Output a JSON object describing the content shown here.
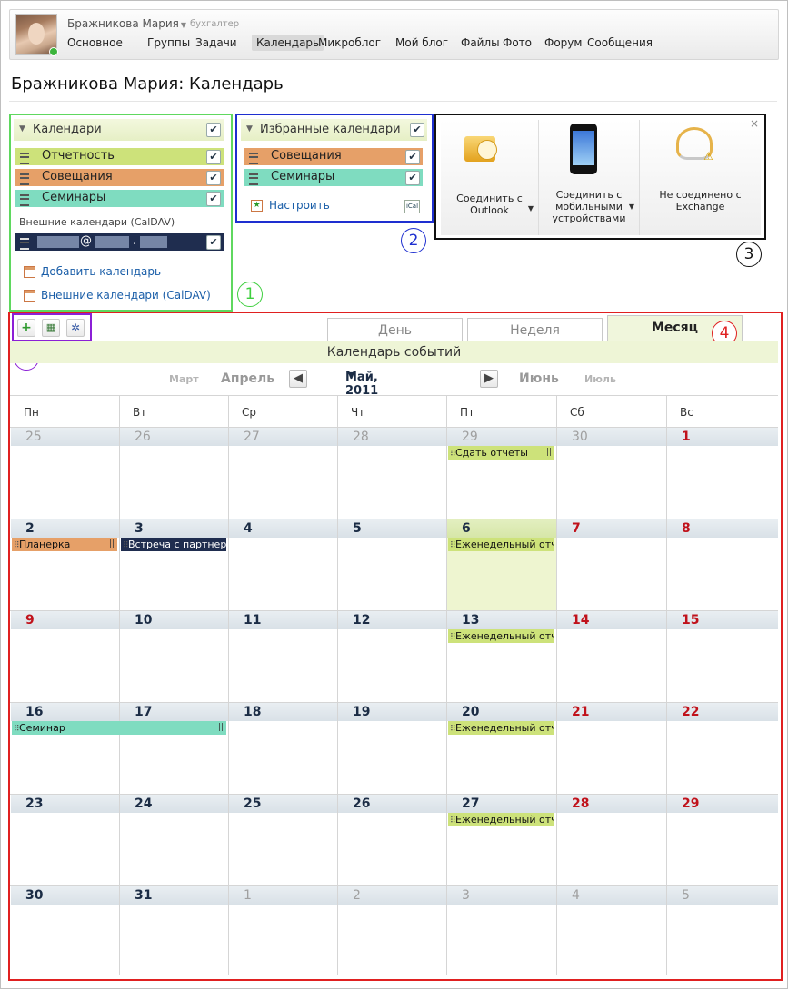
{
  "user": {
    "name": "Бражникова Мария",
    "position": "бухгалтер"
  },
  "nav": [
    {
      "label": "Основное"
    },
    {
      "label": "Группы"
    },
    {
      "label": "Задачи"
    },
    {
      "label": "Календарь",
      "active": true
    },
    {
      "label": "Микроблог"
    },
    {
      "label": "Мой блог"
    },
    {
      "label": "Файлы"
    },
    {
      "label": "Фото"
    },
    {
      "label": "Форум"
    },
    {
      "label": "Сообщения"
    }
  ],
  "page_title": "Бражникова Мария: Календарь",
  "calendars_panel": {
    "title": "Календари",
    "items": [
      {
        "label": "Отчетность",
        "color": "#cde27a"
      },
      {
        "label": "Совещания",
        "color": "#e6a068"
      },
      {
        "label": "Семинары",
        "color": "#7fdcc0"
      }
    ],
    "external_title": "Внешние календари (CalDAV)",
    "external_item": {
      "label": "@.",
      "color": "#1f2d4f"
    },
    "add_link": "Добавить календарь",
    "external_link": "Внешние календари (CalDAV)"
  },
  "favorites_panel": {
    "title": "Избранные календари",
    "items": [
      {
        "label": "Совещания",
        "color": "#e6a068"
      },
      {
        "label": "Семинары",
        "color": "#7fdcc0"
      }
    ],
    "settings_link": "Настроить"
  },
  "connect_panel": {
    "outlook": "Соединить с Outlook",
    "mobile": "Соединить с мобильными устройствами",
    "exchange": "Не соединено с Exchange",
    "close": "×"
  },
  "callouts": [
    "1",
    "2",
    "3",
    "4",
    "5"
  ],
  "tabs": {
    "day": "День",
    "week": "Неделя",
    "month": "Месяц"
  },
  "events_bar": "Календарь событий",
  "month_nav": {
    "prev2": "Март",
    "prev1": "Апрель",
    "current": "Май, 2011",
    "next1": "Июнь",
    "next2": "Июль"
  },
  "weekdays": [
    "Пн",
    "Вт",
    "Ср",
    "Чт",
    "Пт",
    "Сб",
    "Вс"
  ],
  "weeks": [
    [
      {
        "d": "25",
        "o": true
      },
      {
        "d": "26",
        "o": true
      },
      {
        "d": "27",
        "o": true
      },
      {
        "d": "28",
        "o": true
      },
      {
        "d": "29",
        "o": true
      },
      {
        "d": "30",
        "o": true
      },
      {
        "d": "1",
        "w": true
      }
    ],
    [
      {
        "d": "2"
      },
      {
        "d": "3"
      },
      {
        "d": "4"
      },
      {
        "d": "5"
      },
      {
        "d": "6",
        "t": true
      },
      {
        "d": "7",
        "w": true
      },
      {
        "d": "8",
        "w": true
      }
    ],
    [
      {
        "d": "9",
        "w": true
      },
      {
        "d": "10"
      },
      {
        "d": "11"
      },
      {
        "d": "12"
      },
      {
        "d": "13"
      },
      {
        "d": "14",
        "w": true
      },
      {
        "d": "15",
        "w": true
      }
    ],
    [
      {
        "d": "16"
      },
      {
        "d": "17"
      },
      {
        "d": "18"
      },
      {
        "d": "19"
      },
      {
        "d": "20"
      },
      {
        "d": "21",
        "w": true
      },
      {
        "d": "22",
        "w": true
      }
    ],
    [
      {
        "d": "23"
      },
      {
        "d": "24"
      },
      {
        "d": "25"
      },
      {
        "d": "26"
      },
      {
        "d": "27"
      },
      {
        "d": "28",
        "w": true
      },
      {
        "d": "29",
        "w": true
      }
    ],
    [
      {
        "d": "30"
      },
      {
        "d": "31"
      },
      {
        "d": "1",
        "o": true
      },
      {
        "d": "2",
        "o": true
      },
      {
        "d": "3",
        "o": true
      },
      {
        "d": "4",
        "o": true
      },
      {
        "d": "5",
        "o": true
      }
    ]
  ],
  "events": [
    {
      "week": 0,
      "col": 4,
      "span": 1,
      "label": "Сдать отчеты",
      "color": "#cde27a",
      "text_color": "#111",
      "end": "||"
    },
    {
      "week": 1,
      "col": 0,
      "span": 1,
      "label": "Планерка",
      "color": "#e6a068",
      "text_color": "#111",
      "end": "||"
    },
    {
      "week": 1,
      "col": 1,
      "span": 1,
      "label": "Встреча с партнер",
      "color": "#1f2d4f",
      "text_color": "#ffffff",
      "end": ""
    },
    {
      "week": 1,
      "col": 4,
      "span": 1,
      "label": "Еженедельный отч",
      "color": "#cde27a",
      "text_color": "#111",
      "end": ""
    },
    {
      "week": 2,
      "col": 4,
      "span": 1,
      "label": "Еженедельный отч",
      "color": "#cde27a",
      "text_color": "#111",
      "end": ""
    },
    {
      "week": 3,
      "col": 0,
      "span": 2,
      "label": "Семинар",
      "color": "#7fdcc0",
      "text_color": "#111",
      "end": "||"
    },
    {
      "week": 3,
      "col": 4,
      "span": 1,
      "label": "Еженедельный отч",
      "color": "#cde27a",
      "text_color": "#111",
      "end": ""
    },
    {
      "week": 4,
      "col": 4,
      "span": 1,
      "label": "Еженедельный отч",
      "color": "#cde27a",
      "text_color": "#111",
      "end": ""
    }
  ]
}
